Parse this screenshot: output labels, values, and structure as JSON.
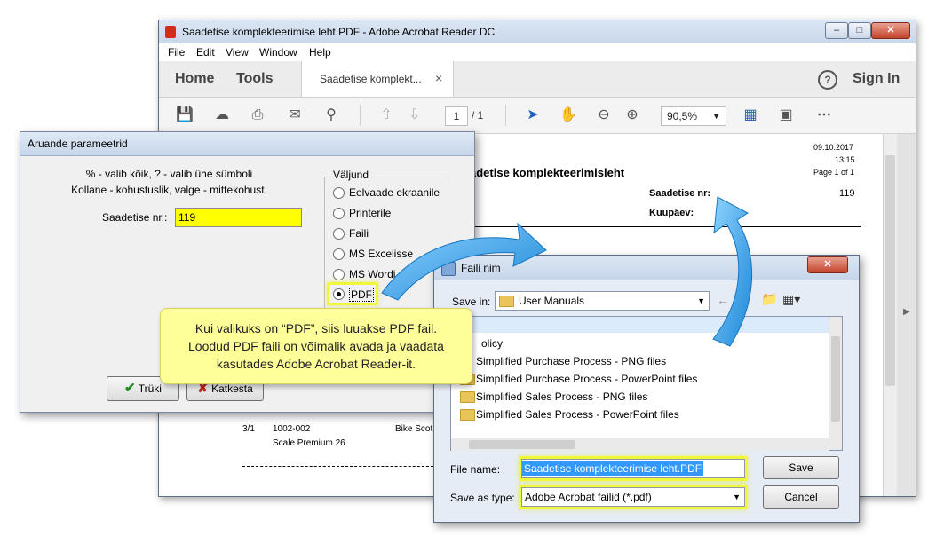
{
  "acrobat": {
    "title": "Saadetise komplekteerimise leht.PDF - Adobe Acrobat Reader DC",
    "menu": [
      "File",
      "Edit",
      "View",
      "Window",
      "Help"
    ],
    "nav": {
      "home": "Home",
      "tools": "Tools",
      "tab_label": "Saadetise komplekt...",
      "sign_in": "Sign In"
    },
    "toolbar": {
      "page_current": "1",
      "page_total": "/ 1",
      "zoom": "90,5%"
    },
    "page": {
      "date": "09.10.2017",
      "time": "13:15",
      "page_of": "Page 1 of 1",
      "heading": "adetise komplekteerimisleht",
      "saadetise_label": "Saadetise nr:",
      "saadetise_value": "119",
      "kuupaev_label": "Kuupäev:",
      "row_qty": "3/1",
      "row_code": "1002-002",
      "row_name": "Bike Scot",
      "row_desc": "Scale Premium 26"
    }
  },
  "aruande": {
    "title": "Aruande parameetrid",
    "hint1": "% - valib kõik, ? - valib ühe sümboli",
    "hint2": "Kollane - kohustuslik, valge - mittekohust.",
    "field_label": "Saadetise nr.:",
    "field_value": "119",
    "group_title": "Väljund",
    "options": [
      "Eelvaade ekraanile",
      "Printerile",
      "Faili",
      "MS Excelisse",
      "MS Wordi",
      "PDF"
    ],
    "selected_option": "PDF",
    "btn_print": "Trüki",
    "btn_cancel": "Katkesta"
  },
  "save_dialog": {
    "title": "Faili nim",
    "save_in_label": "Save in:",
    "save_in_value": "User Manuals",
    "items": [
      "olicy",
      "Simplified Purchase Process - PNG files",
      "Simplified Purchase Process - PowerPoint files",
      "Simplified Sales Process - PNG files",
      "Simplified Sales Process - PowerPoint files"
    ],
    "file_name_label": "File name:",
    "file_name_value": "Saadetise komplekteerimise leht.PDF",
    "save_type_label": "Save as type:",
    "save_type_value": "Adobe Acrobat failid (*.pdf)",
    "btn_save": "Save",
    "btn_cancel": "Cancel"
  },
  "callout": {
    "line1": "Kui valikuks on “PDF”, siis luuakse PDF fail.",
    "line2": "Loodud PDF faili on võimalik avada ja vaadata",
    "line3": "kasutades Adobe Acrobat Reader-it."
  },
  "colors": {
    "highlight": "#f1f73a",
    "field_yellow": "#ffff00",
    "callout": "#ffff9a",
    "arrow": "#2aa0e6",
    "acrobat_red": "#d42a1f"
  }
}
